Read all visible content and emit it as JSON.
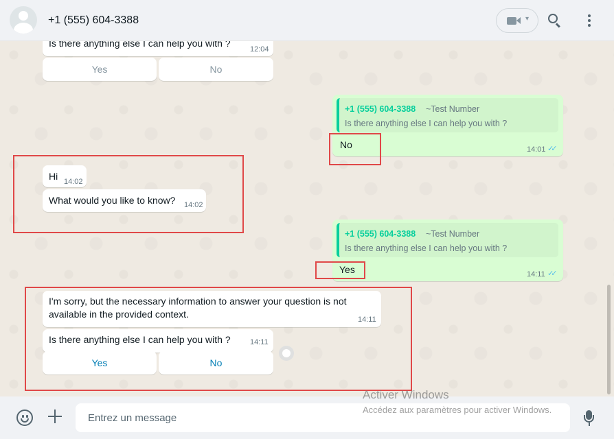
{
  "header": {
    "contact_name": "+1 (555) 604-3388",
    "icons": [
      "avatar-icon",
      "video-call-icon",
      "chevron-down-icon",
      "search-icon",
      "menu-icon"
    ]
  },
  "messages": {
    "m1": {
      "text": "Is there anything else I can help you with ?",
      "time": "12:04"
    },
    "m1_buttons": {
      "yes": "Yes",
      "no": "No"
    },
    "r1": {
      "quote_name": "+1 (555) 604-3388",
      "quote_sub": "~Test Number",
      "quote_text": "Is there anything else I can help you with ?",
      "text": "No",
      "time": "14:01"
    },
    "m2": {
      "text": "Hi",
      "time": "14:02"
    },
    "m3": {
      "text": "What would you like to know?",
      "time": "14:02"
    },
    "r2": {
      "quote_name": "+1 (555) 604-3388",
      "quote_sub": "~Test Number",
      "quote_text": "Is there anything else I can help you with ?",
      "text": "Yes",
      "time": "14:11"
    },
    "m4": {
      "line1": "I'm sorry, but the necessary information to answer your question is not",
      "line2": "available in the provided context.",
      "time": "14:11"
    },
    "m5": {
      "text": "Is there anything else I can help you with ?",
      "time": "14:11"
    },
    "m5_buttons": {
      "yes": "Yes",
      "no": "No"
    }
  },
  "footer": {
    "input_placeholder": "Entrez un message"
  },
  "watermark": {
    "title": "Activer Windows",
    "subtitle": "Accédez aux paramètres pour activer Windows."
  },
  "colors": {
    "accent": "#027eb5",
    "outgoing_bubble": "#d9fdd3",
    "quote_green": "#06cf9c",
    "highlight": "#e04848"
  }
}
